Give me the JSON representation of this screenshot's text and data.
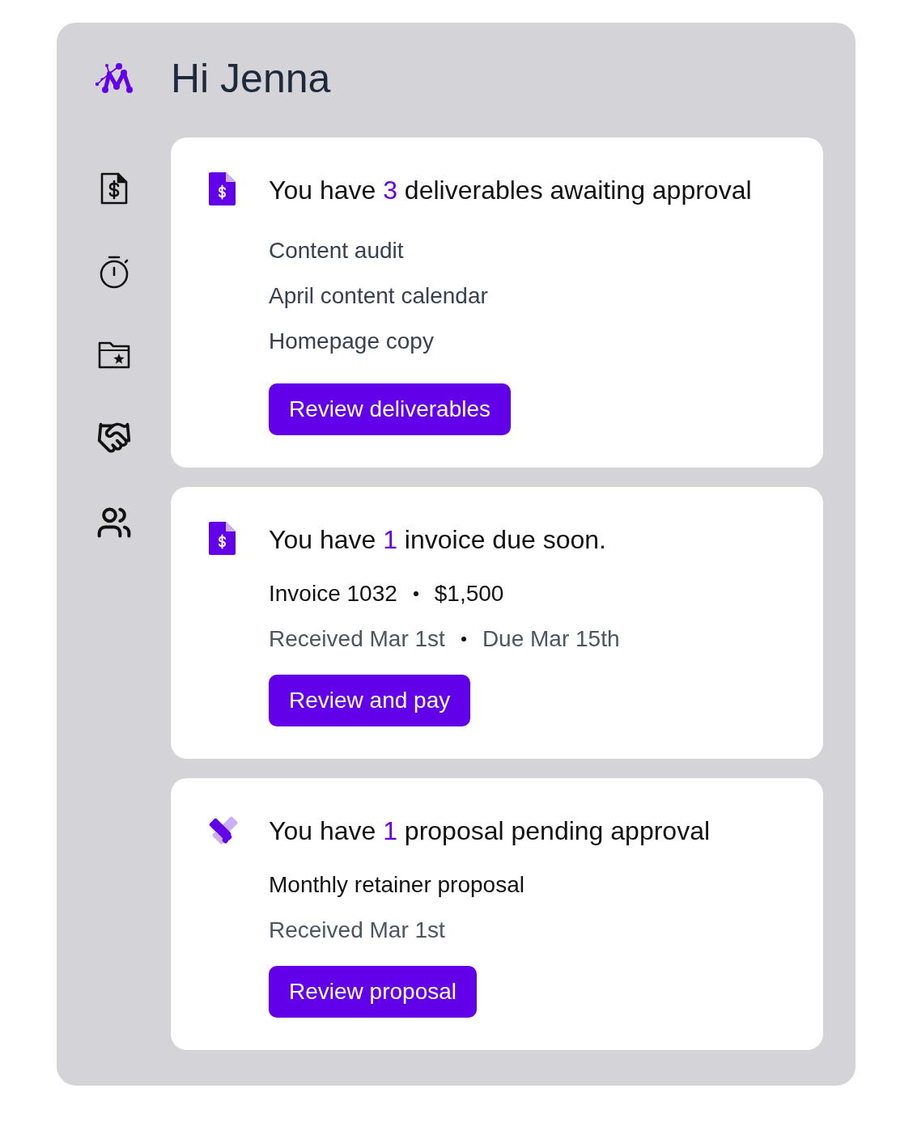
{
  "header": {
    "greeting": "Hi Jenna"
  },
  "cards": [
    {
      "kind": "deliverables",
      "headline": {
        "before": "You have",
        "count": "3",
        "after": "deliverables awaiting approval"
      },
      "items": [
        "Content audit",
        "April content calendar",
        "Homepage copy"
      ],
      "button": "Review deliverables"
    },
    {
      "kind": "invoice",
      "headline": {
        "before": "You have",
        "count": "1",
        "after": "invoice due soon."
      },
      "details": [
        "Invoice 1032",
        "$1,500"
      ],
      "meta": [
        "Received Mar 1st",
        "Due Mar 15th"
      ],
      "button": "Review and pay"
    },
    {
      "kind": "proposal",
      "headline": {
        "before": "You have",
        "count": "1",
        "after": "proposal pending approval"
      },
      "details": [
        "Monthly retainer proposal"
      ],
      "meta": [
        "Received Mar 1st"
      ],
      "button": "Review proposal"
    }
  ]
}
